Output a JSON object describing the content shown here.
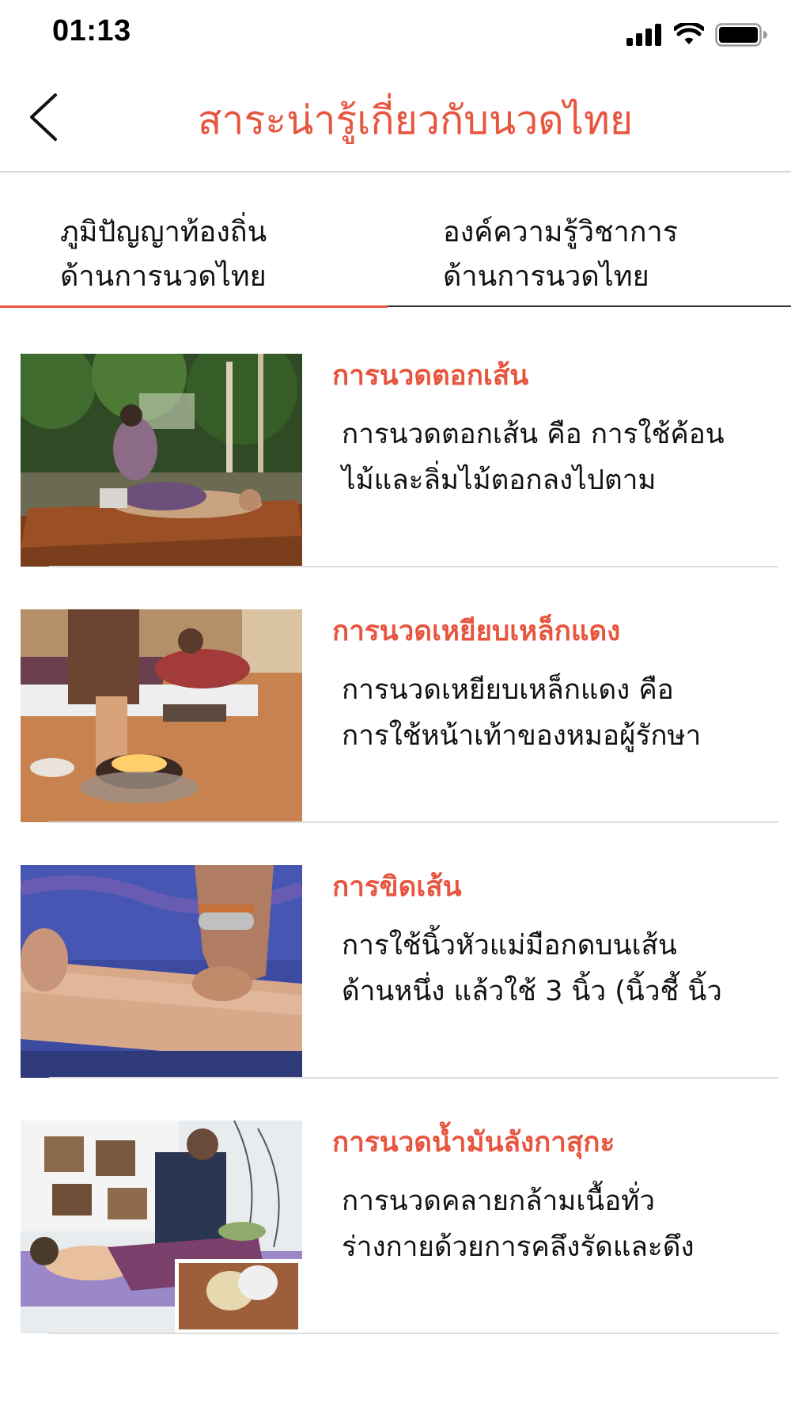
{
  "status_bar": {
    "time": "01:13",
    "signal_icon": "cellular-signal-icon",
    "wifi_icon": "wifi-icon",
    "battery_icon": "battery-icon"
  },
  "header": {
    "back_icon": "chevron-left-icon",
    "title": "สาระน่ารู้เกี่ยวกับนวดไทย",
    "accent_color": "#e8553f"
  },
  "tabs": [
    {
      "line1": "ภูมิปัญญาท้องถิ่น",
      "line2": "ด้านการนวดไทย",
      "active": true
    },
    {
      "line1": "องค์ความรู้วิชาการ",
      "line2": "ด้านการนวดไทย",
      "active": false
    }
  ],
  "articles": [
    {
      "title": "การนวดตอกเส้น",
      "excerpt_line1": "การนวดตอกเส้น คือ การใช้ค้อน",
      "excerpt_line2": "ไม้และลิ่มไม้ตอกลงไปตาม",
      "image": "photo-tapping-massage"
    },
    {
      "title": "การนวดเหยียบเหล็กแดง",
      "excerpt_line1": "การนวดเหยียบเหล็กแดง คือ",
      "excerpt_line2": "การใช้หน้าเท้าของหมอผู้รักษา",
      "image": "photo-hot-iron-foot-massage"
    },
    {
      "title": "การขิดเส้น",
      "excerpt_line1": "การใช้นิ้วหัวแม่มือกดบนเส้น",
      "excerpt_line2": "ด้านหนึ่ง แล้วใช้ 3 นิ้ว (นิ้วชี้ นิ้ว",
      "image": "photo-thumb-pressing-arm"
    },
    {
      "title": "การนวดน้ำมันลังกาสุกะ",
      "excerpt_line1": "การนวดคลายกล้ามเนื้อทั่ว",
      "excerpt_line2": "ร่างกายด้วยการคลึงรัดและดึง",
      "image": "photo-oil-massage"
    }
  ]
}
